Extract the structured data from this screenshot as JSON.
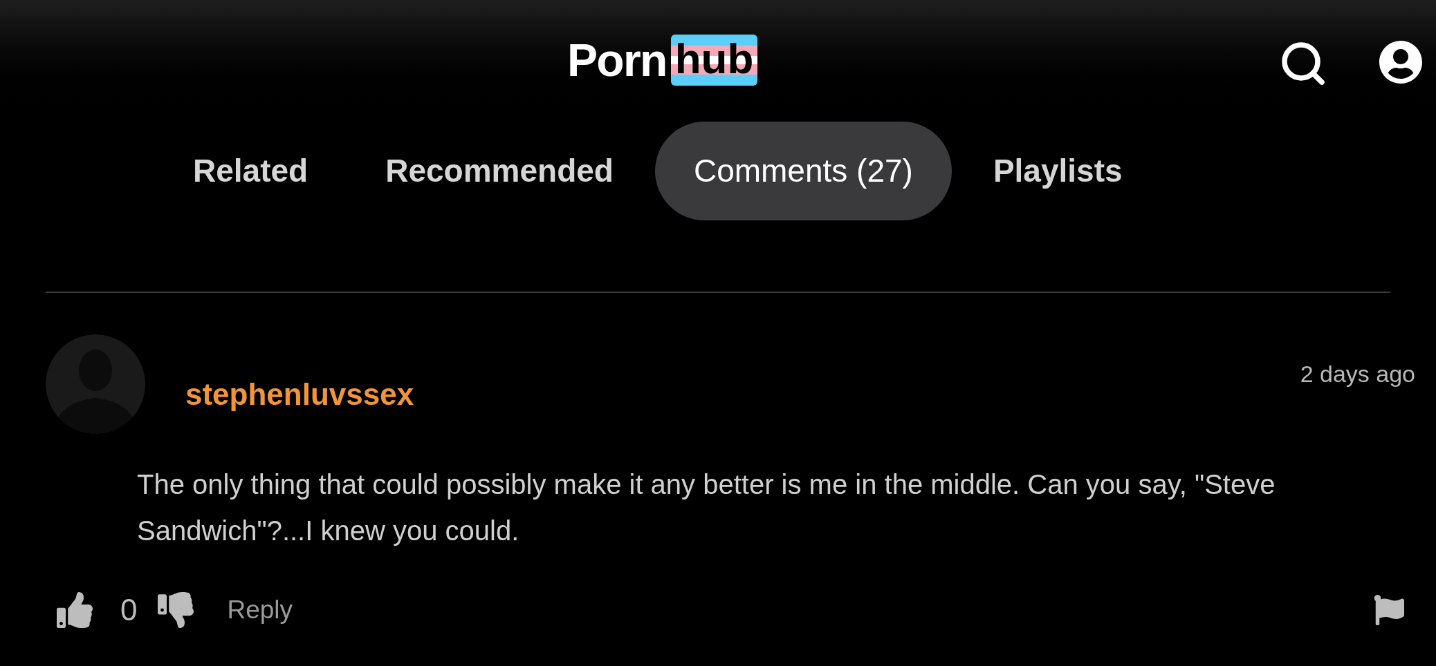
{
  "header": {
    "logo": {
      "first": "Porn",
      "second": "hub"
    }
  },
  "tabs": [
    {
      "label": "Related",
      "selected": false
    },
    {
      "label": "Recommended",
      "selected": false
    },
    {
      "label": "Comments (27)",
      "selected": true
    },
    {
      "label": "Playlists",
      "selected": false
    }
  ],
  "comment": {
    "username": "stephenluvssex",
    "time": "2 days ago",
    "text": "The only thing that could possibly make it any better is me in the middle. Can you say, \"Steve Sandwich\"?...I knew you could.",
    "votes": "0",
    "reply": "Reply"
  }
}
